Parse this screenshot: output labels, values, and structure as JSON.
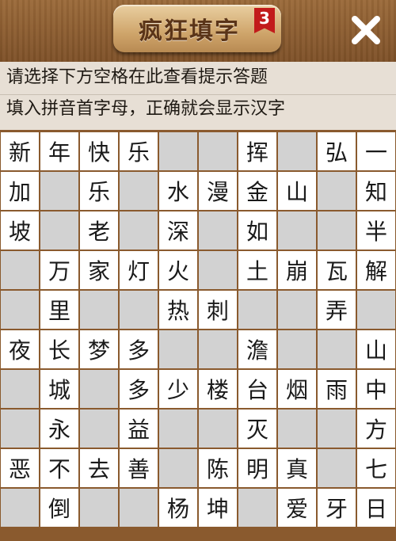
{
  "header": {
    "title": "疯狂填字",
    "level": "3",
    "close_icon": "close-x-icon"
  },
  "hints": {
    "line1": "请选择下方空格在此查看提示答题",
    "line2": "填入拼音首字母，正确就会显示汉字"
  },
  "grid": {
    "rows": [
      [
        "新",
        "年",
        "快",
        "乐",
        "",
        "",
        "挥",
        "",
        "弘",
        "一"
      ],
      [
        "加",
        "",
        "乐",
        "",
        "水",
        "漫",
        "金",
        "山",
        "",
        "知"
      ],
      [
        "坡",
        "",
        "老",
        "",
        "深",
        "",
        "如",
        "",
        "",
        "半"
      ],
      [
        "",
        "万",
        "家",
        "灯",
        "火",
        "",
        "土",
        "崩",
        "瓦",
        "解"
      ],
      [
        "",
        "里",
        "",
        "",
        "热",
        "刺",
        "",
        "",
        "弄",
        ""
      ],
      [
        "夜",
        "长",
        "梦",
        "多",
        "",
        "",
        "澹",
        "",
        "",
        "山"
      ],
      [
        "",
        "城",
        "",
        "多",
        "少",
        "楼",
        "台",
        "烟",
        "雨",
        "中"
      ],
      [
        "",
        "永",
        "",
        "益",
        "",
        "",
        "灭",
        "",
        "",
        "方"
      ],
      [
        "恶",
        "不",
        "去",
        "善",
        "",
        "陈",
        "明",
        "真",
        "",
        "七"
      ],
      [
        "",
        "倒",
        "",
        "",
        "杨",
        "坤",
        "",
        "爱",
        "牙",
        "日"
      ]
    ]
  }
}
